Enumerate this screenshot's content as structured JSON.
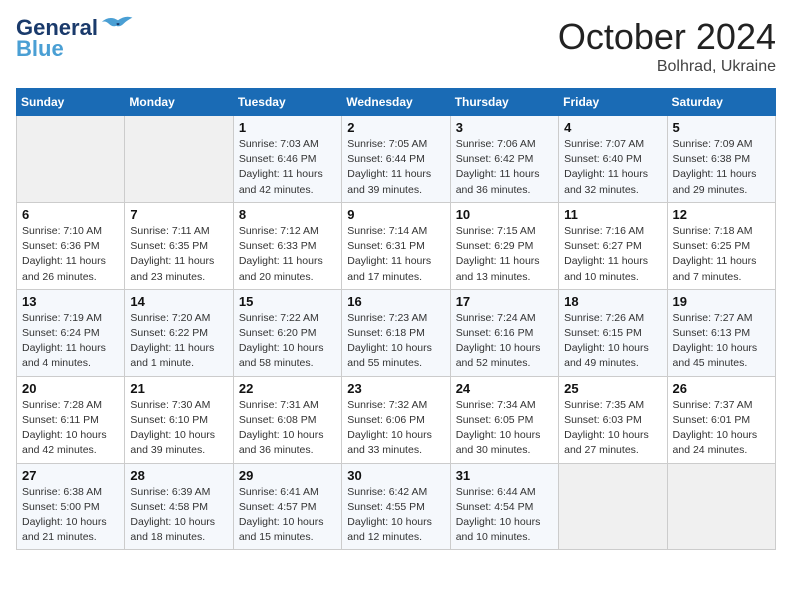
{
  "logo": {
    "line1": "General",
    "line2": "Blue"
  },
  "title": "October 2024",
  "location": "Bolhrad, Ukraine",
  "days_header": [
    "Sunday",
    "Monday",
    "Tuesday",
    "Wednesday",
    "Thursday",
    "Friday",
    "Saturday"
  ],
  "weeks": [
    [
      {
        "day": "",
        "info": ""
      },
      {
        "day": "",
        "info": ""
      },
      {
        "day": "1",
        "info": "Sunrise: 7:03 AM\nSunset: 6:46 PM\nDaylight: 11 hours and 42 minutes."
      },
      {
        "day": "2",
        "info": "Sunrise: 7:05 AM\nSunset: 6:44 PM\nDaylight: 11 hours and 39 minutes."
      },
      {
        "day": "3",
        "info": "Sunrise: 7:06 AM\nSunset: 6:42 PM\nDaylight: 11 hours and 36 minutes."
      },
      {
        "day": "4",
        "info": "Sunrise: 7:07 AM\nSunset: 6:40 PM\nDaylight: 11 hours and 32 minutes."
      },
      {
        "day": "5",
        "info": "Sunrise: 7:09 AM\nSunset: 6:38 PM\nDaylight: 11 hours and 29 minutes."
      }
    ],
    [
      {
        "day": "6",
        "info": "Sunrise: 7:10 AM\nSunset: 6:36 PM\nDaylight: 11 hours and 26 minutes."
      },
      {
        "day": "7",
        "info": "Sunrise: 7:11 AM\nSunset: 6:35 PM\nDaylight: 11 hours and 23 minutes."
      },
      {
        "day": "8",
        "info": "Sunrise: 7:12 AM\nSunset: 6:33 PM\nDaylight: 11 hours and 20 minutes."
      },
      {
        "day": "9",
        "info": "Sunrise: 7:14 AM\nSunset: 6:31 PM\nDaylight: 11 hours and 17 minutes."
      },
      {
        "day": "10",
        "info": "Sunrise: 7:15 AM\nSunset: 6:29 PM\nDaylight: 11 hours and 13 minutes."
      },
      {
        "day": "11",
        "info": "Sunrise: 7:16 AM\nSunset: 6:27 PM\nDaylight: 11 hours and 10 minutes."
      },
      {
        "day": "12",
        "info": "Sunrise: 7:18 AM\nSunset: 6:25 PM\nDaylight: 11 hours and 7 minutes."
      }
    ],
    [
      {
        "day": "13",
        "info": "Sunrise: 7:19 AM\nSunset: 6:24 PM\nDaylight: 11 hours and 4 minutes."
      },
      {
        "day": "14",
        "info": "Sunrise: 7:20 AM\nSunset: 6:22 PM\nDaylight: 11 hours and 1 minute."
      },
      {
        "day": "15",
        "info": "Sunrise: 7:22 AM\nSunset: 6:20 PM\nDaylight: 10 hours and 58 minutes."
      },
      {
        "day": "16",
        "info": "Sunrise: 7:23 AM\nSunset: 6:18 PM\nDaylight: 10 hours and 55 minutes."
      },
      {
        "day": "17",
        "info": "Sunrise: 7:24 AM\nSunset: 6:16 PM\nDaylight: 10 hours and 52 minutes."
      },
      {
        "day": "18",
        "info": "Sunrise: 7:26 AM\nSunset: 6:15 PM\nDaylight: 10 hours and 49 minutes."
      },
      {
        "day": "19",
        "info": "Sunrise: 7:27 AM\nSunset: 6:13 PM\nDaylight: 10 hours and 45 minutes."
      }
    ],
    [
      {
        "day": "20",
        "info": "Sunrise: 7:28 AM\nSunset: 6:11 PM\nDaylight: 10 hours and 42 minutes."
      },
      {
        "day": "21",
        "info": "Sunrise: 7:30 AM\nSunset: 6:10 PM\nDaylight: 10 hours and 39 minutes."
      },
      {
        "day": "22",
        "info": "Sunrise: 7:31 AM\nSunset: 6:08 PM\nDaylight: 10 hours and 36 minutes."
      },
      {
        "day": "23",
        "info": "Sunrise: 7:32 AM\nSunset: 6:06 PM\nDaylight: 10 hours and 33 minutes."
      },
      {
        "day": "24",
        "info": "Sunrise: 7:34 AM\nSunset: 6:05 PM\nDaylight: 10 hours and 30 minutes."
      },
      {
        "day": "25",
        "info": "Sunrise: 7:35 AM\nSunset: 6:03 PM\nDaylight: 10 hours and 27 minutes."
      },
      {
        "day": "26",
        "info": "Sunrise: 7:37 AM\nSunset: 6:01 PM\nDaylight: 10 hours and 24 minutes."
      }
    ],
    [
      {
        "day": "27",
        "info": "Sunrise: 6:38 AM\nSunset: 5:00 PM\nDaylight: 10 hours and 21 minutes."
      },
      {
        "day": "28",
        "info": "Sunrise: 6:39 AM\nSunset: 4:58 PM\nDaylight: 10 hours and 18 minutes."
      },
      {
        "day": "29",
        "info": "Sunrise: 6:41 AM\nSunset: 4:57 PM\nDaylight: 10 hours and 15 minutes."
      },
      {
        "day": "30",
        "info": "Sunrise: 6:42 AM\nSunset: 4:55 PM\nDaylight: 10 hours and 12 minutes."
      },
      {
        "day": "31",
        "info": "Sunrise: 6:44 AM\nSunset: 4:54 PM\nDaylight: 10 hours and 10 minutes."
      },
      {
        "day": "",
        "info": ""
      },
      {
        "day": "",
        "info": ""
      }
    ]
  ]
}
